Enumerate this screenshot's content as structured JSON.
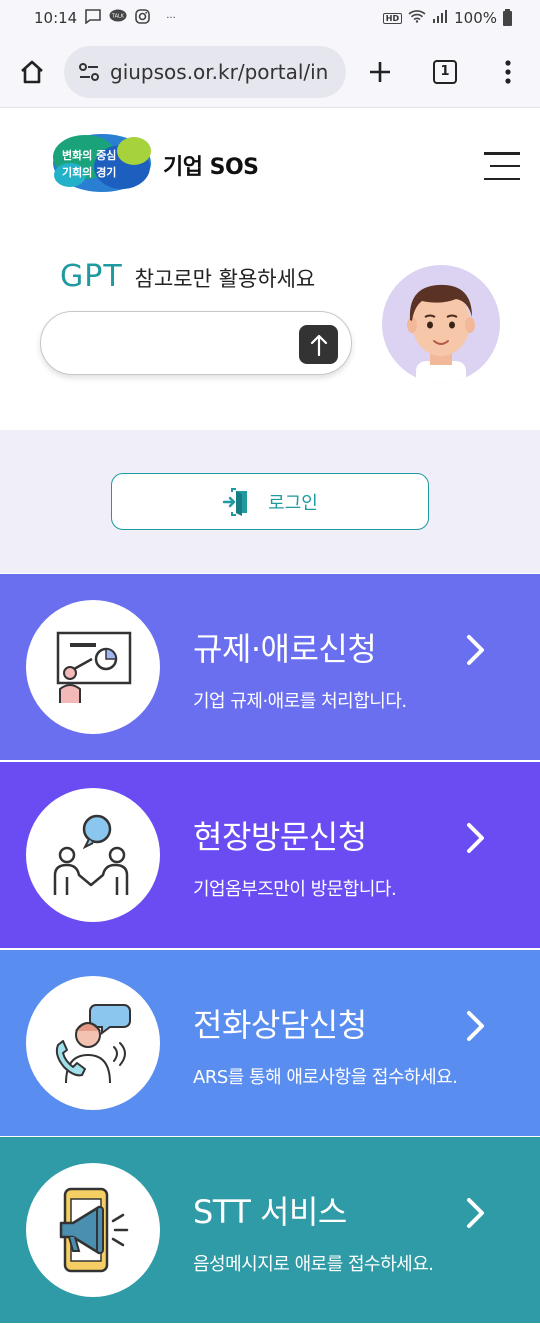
{
  "status_bar": {
    "time": "10:14",
    "notif_dots": "···",
    "hd": "HD",
    "battery": "100%"
  },
  "browser": {
    "url": "giupsos.or.kr/portal/in",
    "tab_count": "1",
    "icons": [
      "home-icon",
      "site-settings-icon",
      "new-tab-icon",
      "tabs-icon",
      "more-menu-icon"
    ]
  },
  "header": {
    "logo_line1": "변화의 중심",
    "logo_line2": "기회의 경기",
    "site_name": "기업 SOS"
  },
  "gpt": {
    "brand": "GPT",
    "description": "참고로만 활용하세요",
    "input_value": "",
    "input_placeholder": ""
  },
  "login": {
    "label": "로그인"
  },
  "services": [
    {
      "title": "규제·애로신청",
      "description": "기업 규제·애로를 처리합니다.",
      "color": "#6a6ff0",
      "icon": "presentation-icon"
    },
    {
      "title": "현장방문신청",
      "description": "기업옴부즈만이 방문합니다.",
      "color": "#6b4cf2",
      "icon": "meeting-icon"
    },
    {
      "title": "전화상담신청",
      "description": "ARS를 통해 애로사항을 접수하세요.",
      "color": "#5a8df0",
      "icon": "phone-consult-icon"
    },
    {
      "title": "STT 서비스",
      "description": "음성메시지로 애로를 접수하세요.",
      "color": "#2f9ba6",
      "icon": "megaphone-phone-icon"
    }
  ],
  "colors": {
    "accent": "#1e9aa0",
    "login_bg": "#f0eef8"
  }
}
